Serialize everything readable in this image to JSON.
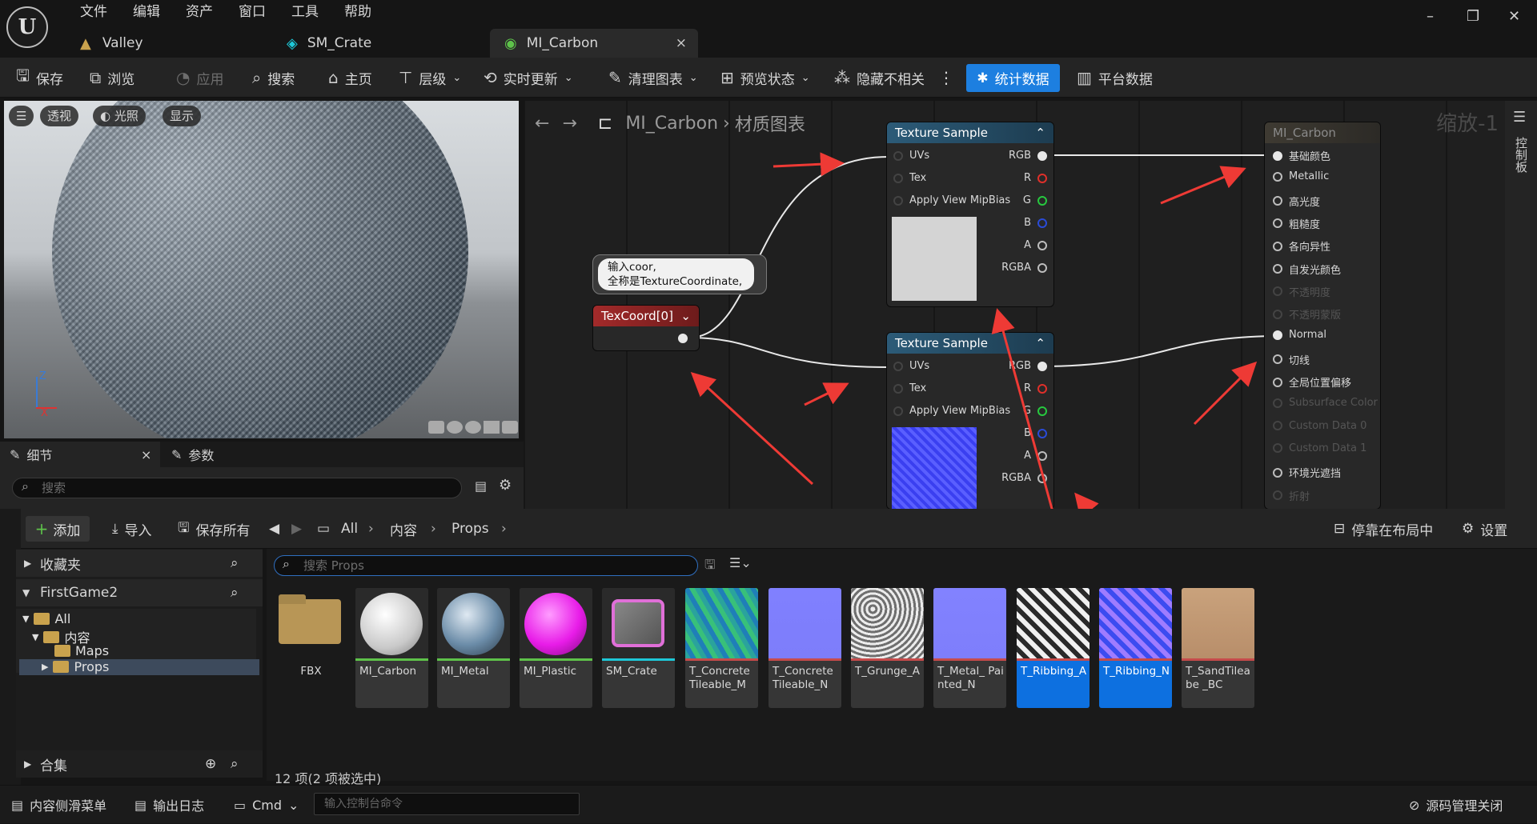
{
  "menu": [
    "文件",
    "编辑",
    "资产",
    "窗口",
    "工具",
    "帮助"
  ],
  "doc_tabs": [
    {
      "label": "Valley"
    },
    {
      "label": "SM_Crate"
    },
    {
      "label": "MI_Carbon",
      "close": "×"
    }
  ],
  "window_controls": {
    "minimize": "–",
    "restore": "❐",
    "close": "✕"
  },
  "toolbar": {
    "save": "保存",
    "browse": "浏览",
    "apply": "应用",
    "search": "搜索",
    "home": "主页",
    "hierarchy": "层级",
    "live_update": "实时更新",
    "clean_graph": "清理图表",
    "preview_state": "预览状态",
    "hide_unrelated": "隐藏不相关",
    "more": "⋮",
    "stats": "统计数据",
    "platform": "平台数据"
  },
  "viewport": {
    "perspective": "透视",
    "lit": "光照",
    "show": "显示",
    "axis_z": "Z",
    "axis_x": "X"
  },
  "details": {
    "tab_details": "细节",
    "tab_close": "×",
    "tab_params": "参数",
    "search_placeholder": "搜索"
  },
  "graph": {
    "breadcrumb_asset": "MI_Carbon",
    "breadcrumb_sep": "›",
    "breadcrumb_graph": "材质图表",
    "zoom": "缩放-1",
    "side_tab": "控制板"
  },
  "comment": {
    "line1": "输入coor,",
    "line2": "全称是TextureCoordinate,"
  },
  "texcoord": {
    "title": "TexCoord[0]"
  },
  "tex1": {
    "title": "Texture Sample",
    "inputs": [
      "UVs",
      "Tex",
      "Apply View MipBias"
    ],
    "outputs": [
      "RGB",
      "R",
      "G",
      "B",
      "A",
      "RGBA"
    ]
  },
  "tex2": {
    "title": "Texture Sample",
    "inputs": [
      "UVs",
      "Tex",
      "Apply View MipBias"
    ],
    "outputs": [
      "RGB",
      "R",
      "G",
      "B",
      "A",
      "RGBA"
    ]
  },
  "result": {
    "title": "MI_Carbon",
    "pins": [
      {
        "label": "基础颜色",
        "active": true
      },
      {
        "label": "Metallic",
        "active": true
      },
      {
        "label": "高光度",
        "active": true
      },
      {
        "label": "粗糙度",
        "active": true
      },
      {
        "label": "各向异性",
        "active": true
      },
      {
        "label": "自发光颜色",
        "active": true
      },
      {
        "label": "不透明度",
        "active": false
      },
      {
        "label": "不透明蒙版",
        "active": false
      },
      {
        "label": "Normal",
        "active": true
      },
      {
        "label": "切线",
        "active": true
      },
      {
        "label": "全局位置偏移",
        "active": true
      },
      {
        "label": "Subsurface Color",
        "active": false
      },
      {
        "label": "Custom Data 0",
        "active": false
      },
      {
        "label": "Custom Data 1",
        "active": false
      },
      {
        "label": "环境光遮挡",
        "active": true
      },
      {
        "label": "折射",
        "active": false
      }
    ]
  },
  "content": {
    "add": "添加",
    "import": "导入",
    "save_all": "保存所有",
    "path": [
      "All",
      "内容",
      "Props"
    ],
    "dock": "停靠在布局中",
    "settings": "设置",
    "search_placeholder": "搜索 Props",
    "count": "12 项(2 项被选中)"
  },
  "left": {
    "favorites": "收藏夹",
    "project": "FirstGame2",
    "tree": [
      "All",
      "内容",
      "Maps",
      "Props"
    ],
    "collections": "合集"
  },
  "assets": [
    {
      "label": "FBX",
      "kind": "folder"
    },
    {
      "label": "MI_Carbon",
      "color": "#5ec34a"
    },
    {
      "label": "MI_Metal",
      "color": "#5ec34a"
    },
    {
      "label": "MI_Plastic",
      "color": "#5ec34a"
    },
    {
      "label": "SM_Crate",
      "color": "#1ec8d8"
    },
    {
      "label": "T_Concrete Tileable_M",
      "color": "#c64b4b"
    },
    {
      "label": "T_Concrete Tileable_N",
      "color": "#c64b4b"
    },
    {
      "label": "T_Grunge_A",
      "color": "#c64b4b"
    },
    {
      "label": "T_Metal_ Painted_N",
      "color": "#c64b4b"
    },
    {
      "label": "T_Ribbing_A",
      "color": "#c64b4b",
      "selected": true
    },
    {
      "label": "T_Ribbing_N",
      "color": "#c64b4b",
      "selected": true
    },
    {
      "label": "T_SandTileabe _BC",
      "color": "#c64b4b"
    }
  ],
  "status": {
    "drawer": "内容侧滑菜单",
    "log": "输出日志",
    "cmd": "Cmd",
    "cmd_placeholder": "输入控制台命令",
    "source": "源码管理关闭"
  }
}
